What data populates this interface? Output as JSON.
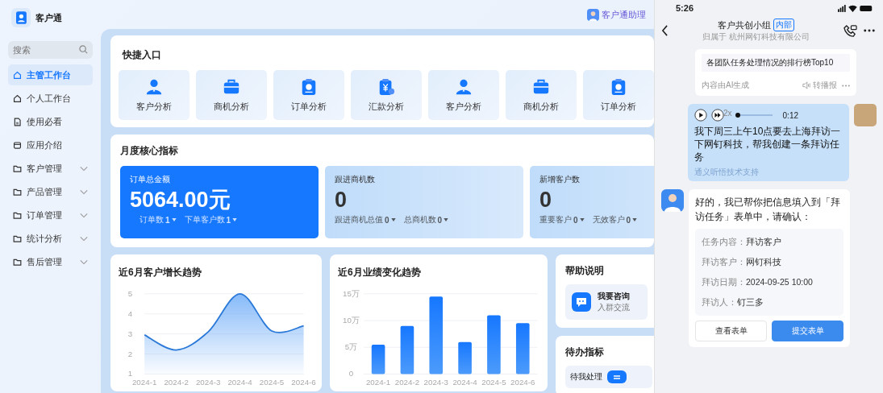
{
  "app": {
    "name": "客户通"
  },
  "header": {
    "assistant": "客户通助理"
  },
  "sidebar": {
    "search_placeholder": "搜索",
    "items": [
      {
        "label": "主管工作台",
        "kind": "home",
        "selected": true,
        "expandable": false
      },
      {
        "label": "个人工作台",
        "kind": "home",
        "selected": false,
        "expandable": false
      },
      {
        "label": "使用必看",
        "kind": "doc",
        "selected": false,
        "expandable": false
      },
      {
        "label": "应用介绍",
        "kind": "card",
        "selected": false,
        "expandable": false
      },
      {
        "label": "客户管理",
        "kind": "folder",
        "selected": false,
        "expandable": true
      },
      {
        "label": "产品管理",
        "kind": "folder",
        "selected": false,
        "expandable": true
      },
      {
        "label": "订单管理",
        "kind": "folder",
        "selected": false,
        "expandable": true
      },
      {
        "label": "统计分析",
        "kind": "folder",
        "selected": false,
        "expandable": true
      },
      {
        "label": "售后管理",
        "kind": "folder",
        "selected": false,
        "expandable": true
      }
    ]
  },
  "quick_entry": {
    "title": "快捷入口",
    "items": [
      {
        "label": "客户分析",
        "kind": "person"
      },
      {
        "label": "商机分析",
        "kind": "briefcase"
      },
      {
        "label": "订单分析",
        "kind": "clipboard"
      },
      {
        "label": "汇款分析",
        "kind": "money"
      },
      {
        "label": "客户分析",
        "kind": "person"
      },
      {
        "label": "商机分析",
        "kind": "briefcase"
      },
      {
        "label": "订单分析",
        "kind": "clipboard"
      }
    ]
  },
  "monthly": {
    "title": "月度核心指标",
    "cards": [
      {
        "title": "订单总金额",
        "value": "5064.00元",
        "highlight": true,
        "subs": [
          {
            "label": "订单数",
            "value": "1"
          },
          {
            "label": "下单客户数",
            "value": "1"
          }
        ]
      },
      {
        "title": "跟进商机数",
        "value": "0",
        "highlight": false,
        "subs": [
          {
            "label": "跟进商机总值",
            "value": "0"
          },
          {
            "label": "总商机数",
            "value": "0"
          }
        ]
      },
      {
        "title": "新增客户数",
        "value": "0",
        "highlight": false,
        "subs": [
          {
            "label": "重要客户",
            "value": "0"
          },
          {
            "label": "无效客户",
            "value": "0"
          }
        ]
      }
    ]
  },
  "customer_trend": {
    "title": "近6月客户增长趋势",
    "chart_data": {
      "type": "area",
      "categories": [
        "2024-1",
        "2024-2",
        "2024-3",
        "2024-4",
        "2024-5",
        "2024-6"
      ],
      "values": [
        2.95,
        2.2,
        3.1,
        5.0,
        3.15,
        3.4
      ],
      "ylim": [
        1,
        5
      ],
      "yticks": [
        1,
        2,
        3,
        4,
        5
      ],
      "grid": true
    }
  },
  "performance_trend": {
    "title": "近6月业绩变化趋势",
    "chart_data": {
      "type": "bar",
      "categories": [
        "2024-1",
        "2024-2",
        "2024-3",
        "2024-4",
        "2024-5",
        "2024-6"
      ],
      "values": [
        5.5,
        9,
        14.5,
        6,
        11,
        9.5
      ],
      "ylim": [
        0,
        15
      ],
      "yticks": [
        {
          "value": 0,
          "label": "0"
        },
        {
          "value": 5,
          "label": "5万"
        },
        {
          "value": 10,
          "label": "10万"
        },
        {
          "value": 15,
          "label": "15万"
        }
      ],
      "grid": true
    }
  },
  "help": {
    "title": "帮助说明",
    "items": [
      {
        "title": "我要咨询",
        "subtitle": "入群交流"
      }
    ]
  },
  "todo": {
    "title": "待办指标",
    "items": [
      {
        "label": "待我处理"
      }
    ]
  },
  "phone": {
    "time": "5:26",
    "chat_title": "客户共创小组",
    "badge": "内部",
    "subtitle": "归属于 杭州网钉科技有限公司",
    "ai_card": {
      "text": "各团队任务处理情况的排行榜Top10",
      "note": "内容由AI生成",
      "action": "转播报"
    },
    "voice_message": {
      "duration": "0:12",
      "speed": "2x",
      "level": 0.05,
      "text": "我下周三上午10点要去上海拜访一下网钉科技，帮我创建一条拜访任务",
      "footnote": "通义听悟技术支持"
    },
    "reply": {
      "text": "好的，我已帮你把信息填入到「拜访任务」表单中，请确认：",
      "fields": [
        {
          "label": "任务内容：",
          "value": "拜访客户"
        },
        {
          "label": "拜访客户：",
          "value": "网钉科技"
        },
        {
          "label": "拜访日期：",
          "value": "2024-09-25 10:00"
        },
        {
          "label": "拜访人：",
          "value": "钉三多"
        }
      ],
      "buttons": [
        {
          "label": "查看表单",
          "primary": false
        },
        {
          "label": "提交表单",
          "primary": true
        }
      ]
    }
  }
}
